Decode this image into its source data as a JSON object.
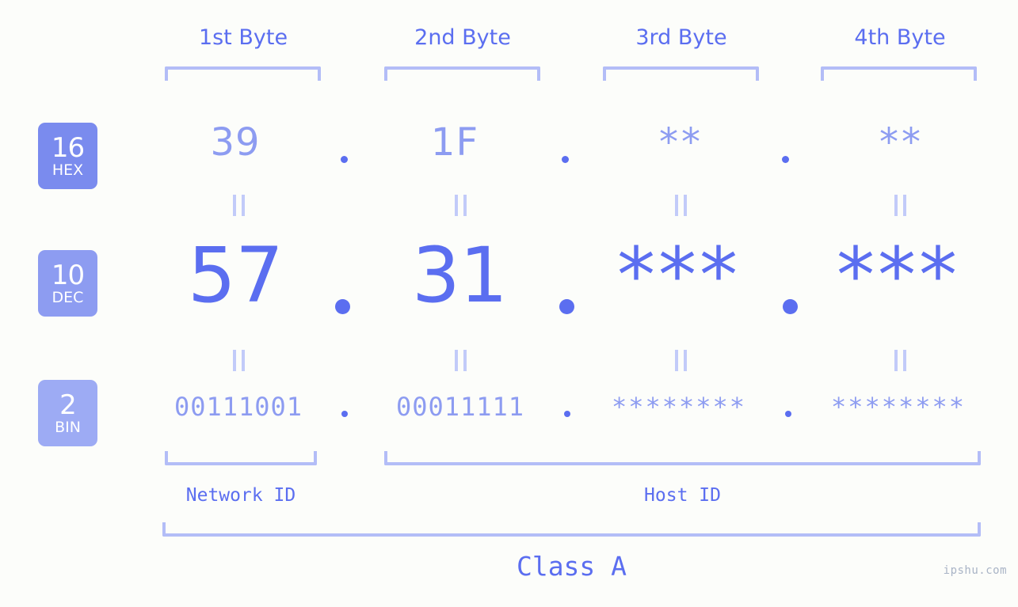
{
  "watermark": "ipshu.com",
  "headers": [
    {
      "label": "1st Byte"
    },
    {
      "label": "2nd Byte"
    },
    {
      "label": "3rd Byte"
    },
    {
      "label": "4th Byte"
    }
  ],
  "bases": [
    {
      "num": "16",
      "name": "HEX",
      "color": "#7a8bee"
    },
    {
      "num": "10",
      "name": "DEC",
      "color": "#8d9cf1"
    },
    {
      "num": "2",
      "name": "BIN",
      "color": "#9dabf4"
    }
  ],
  "separator": ".",
  "equals": "=",
  "rows": {
    "hex": {
      "base": "16",
      "name": "HEX",
      "values": [
        "39",
        "1F",
        "**",
        "**"
      ]
    },
    "dec": {
      "base": "10",
      "name": "DEC",
      "values": [
        "57",
        "31",
        "***",
        "***"
      ]
    },
    "bin": {
      "base": "2",
      "name": "BIN",
      "values": [
        "00111001",
        "00011111",
        "********",
        "********"
      ]
    }
  },
  "segments": {
    "network_id": "Network ID",
    "host_id": "Host ID",
    "class": "Class A"
  },
  "colors": {
    "background": "#fcfdfa",
    "accent": "#5b6ef0",
    "accent_mid": "#8d9cf1",
    "accent_light": "#b3bdf7",
    "badge_hex": "#7a8bee",
    "badge_dec": "#8d9cf1",
    "badge_bin": "#9dabf4",
    "watermark": "#a9b4c6"
  }
}
